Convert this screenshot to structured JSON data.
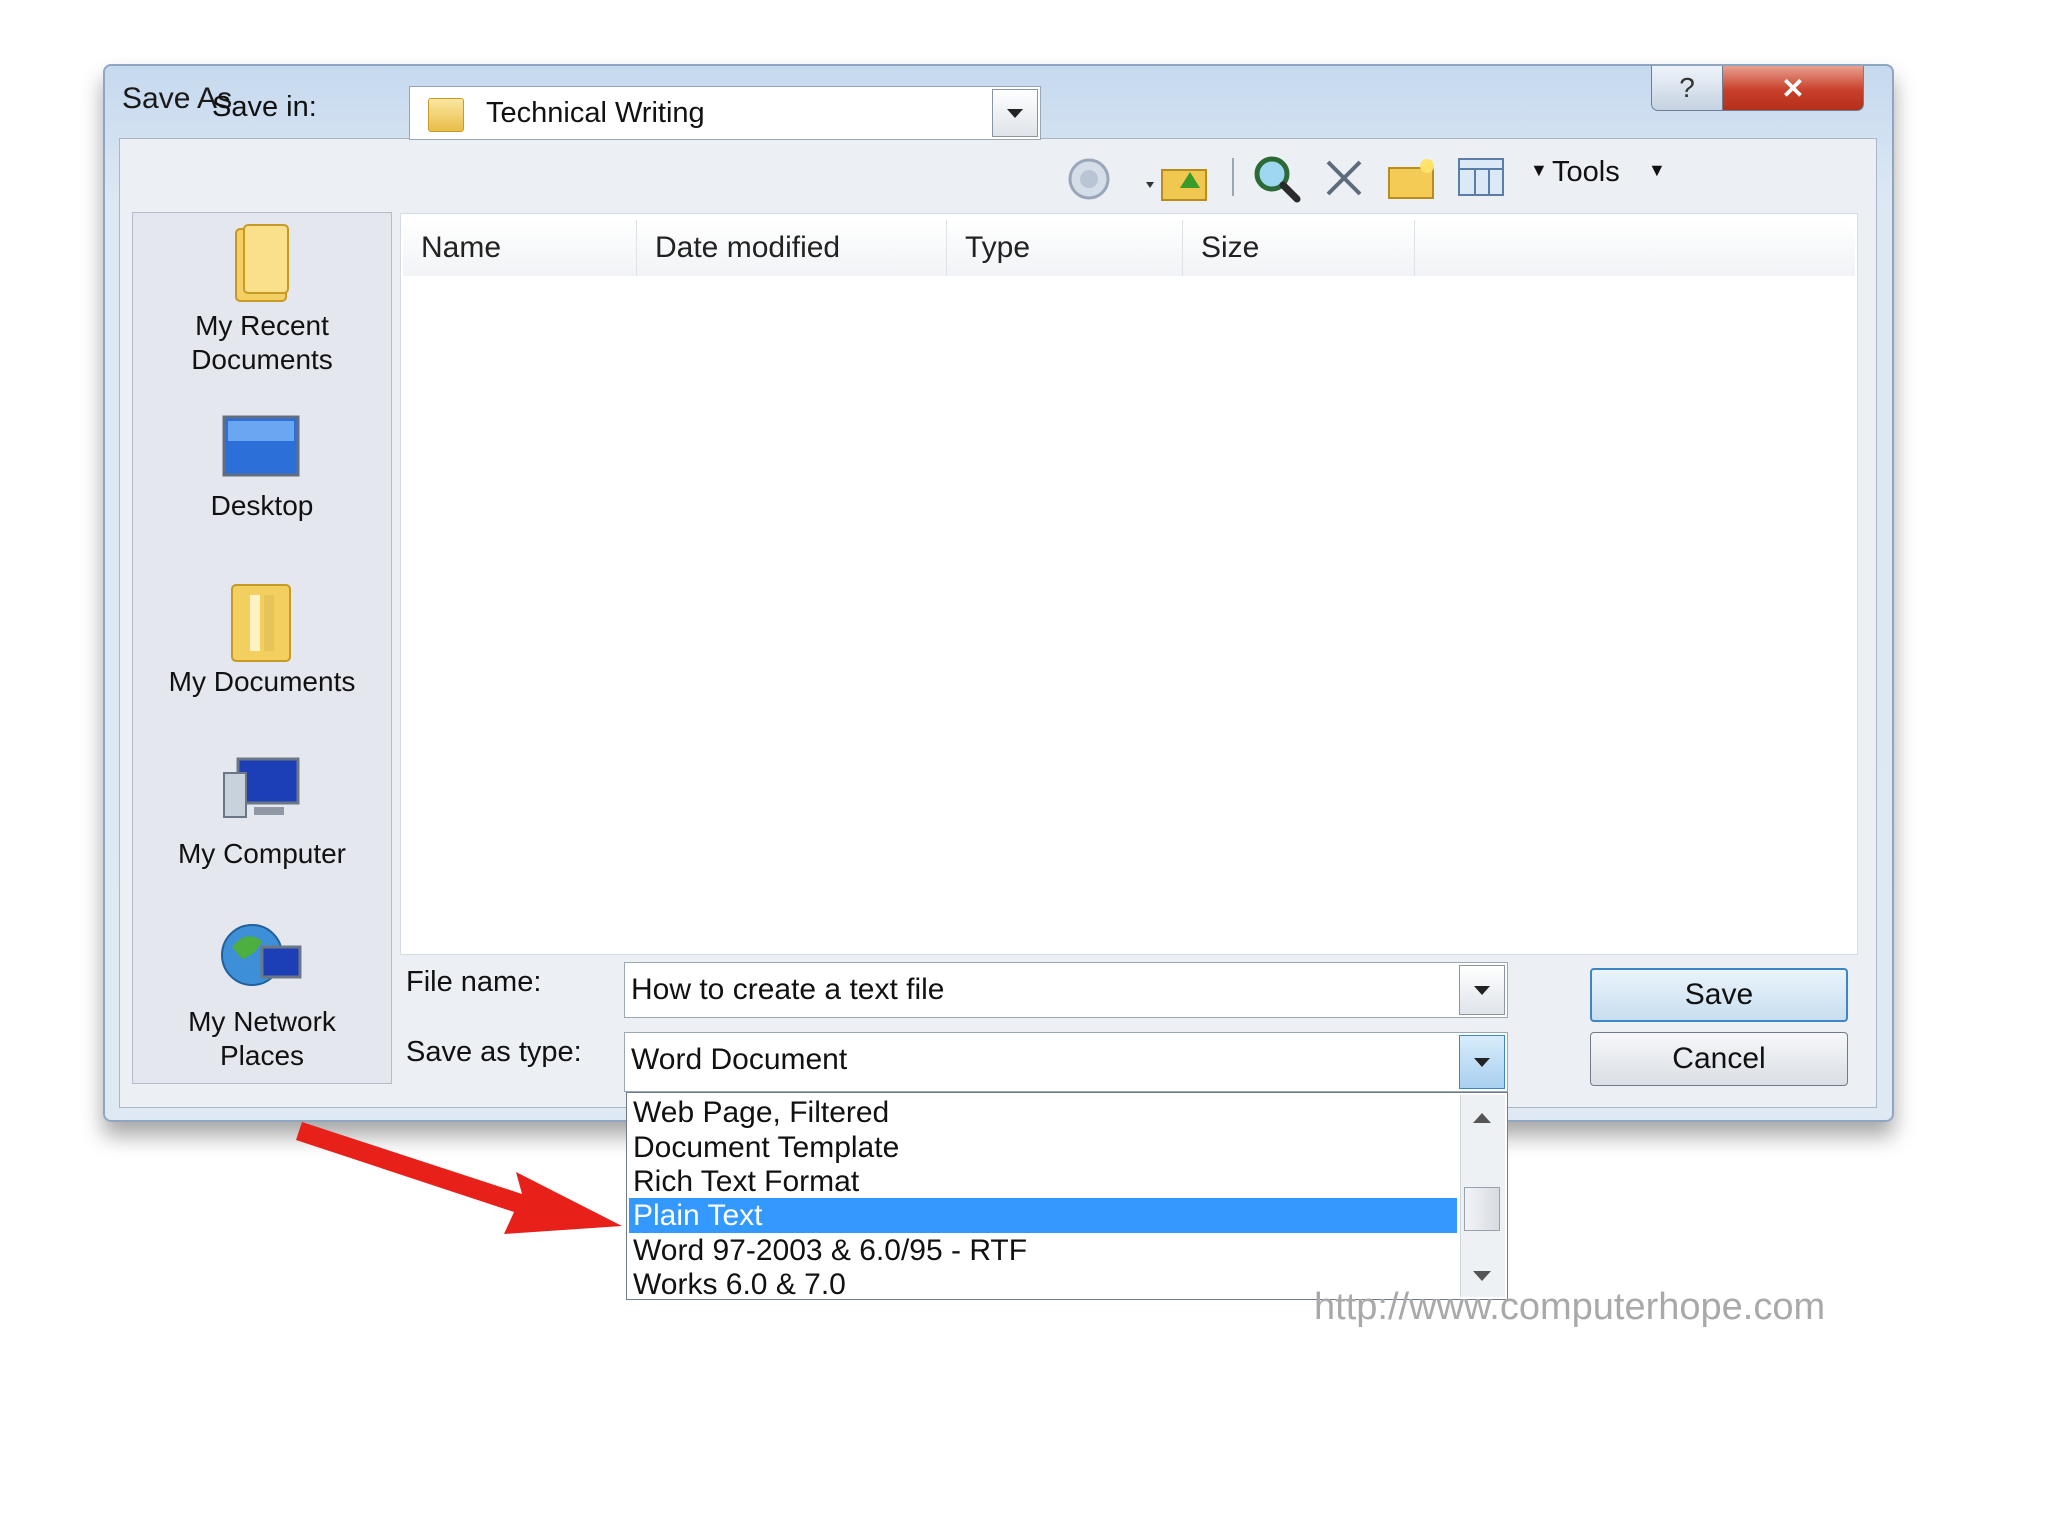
{
  "window": {
    "title": "Save As",
    "help_glyph": "?",
    "close_glyph": "✕"
  },
  "toolbar": {
    "save_in_label": "Save in:",
    "save_in_value": "Technical Writing",
    "tools_label": "Tools",
    "icons": [
      "back-icon",
      "up-folder-icon",
      "search-web-icon",
      "delete-icon",
      "new-folder-icon",
      "views-icon"
    ]
  },
  "file_list": {
    "columns": [
      "Name",
      "Date modified",
      "Type",
      "Size"
    ],
    "rows": []
  },
  "places": [
    {
      "label_1": "My Recent",
      "label_2": "Documents",
      "icon": "recent-documents-icon"
    },
    {
      "label_1": "Desktop",
      "label_2": "",
      "icon": "desktop-icon"
    },
    {
      "label_1": "My Documents",
      "label_2": "",
      "icon": "my-documents-icon"
    },
    {
      "label_1": "My Computer",
      "label_2": "",
      "icon": "my-computer-icon"
    },
    {
      "label_1": "My Network",
      "label_2": "Places",
      "icon": "network-places-icon"
    }
  ],
  "form": {
    "file_name_label": "File name:",
    "file_name_value": "How to create a text file",
    "save_type_label": "Save as type:",
    "save_type_value": "Word Document"
  },
  "buttons": {
    "save": "Save",
    "cancel": "Cancel"
  },
  "type_options": [
    "Web Page, Filtered",
    "Document Template",
    "Rich Text Format",
    "Plain Text",
    "Word 97-2003 & 6.0/95 - RTF",
    "Works 6.0 & 7.0"
  ],
  "selected_option": "Plain Text",
  "watermark": "http://www.computerhope.com",
  "colors": {
    "selection": "#3399ff",
    "annotation_arrow": "#e8201a"
  }
}
